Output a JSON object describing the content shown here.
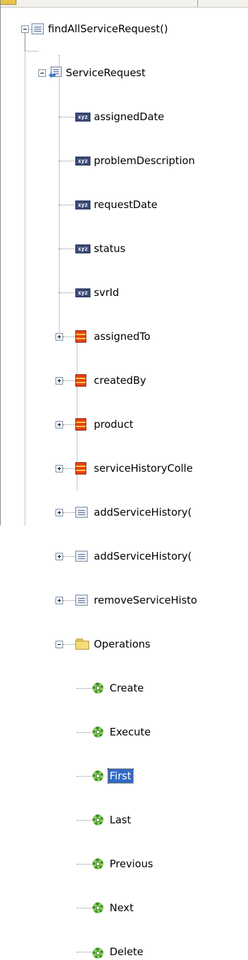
{
  "tree": {
    "root": {
      "label": "findAllServiceRequest()",
      "icon": "method-icon"
    },
    "return_node": {
      "label": "ServiceRequest",
      "icon": "return-collection-icon"
    },
    "attributes": [
      {
        "label": "assignedDate",
        "icon": "attribute-icon",
        "icon_text": "xyz"
      },
      {
        "label": "problemDescription",
        "icon": "attribute-icon",
        "icon_text": "xyz"
      },
      {
        "label": "requestDate",
        "icon": "attribute-icon",
        "icon_text": "xyz"
      },
      {
        "label": "status",
        "icon": "attribute-icon",
        "icon_text": "xyz"
      },
      {
        "label": "svrId",
        "icon": "attribute-icon",
        "icon_text": "xyz"
      }
    ],
    "accessors": [
      {
        "label": "assignedTo",
        "icon": "accessor-icon"
      },
      {
        "label": "createdBy",
        "icon": "accessor-icon"
      },
      {
        "label": "product",
        "icon": "accessor-icon"
      },
      {
        "label": "serviceHistoryColle",
        "icon": "accessor-icon"
      }
    ],
    "methods": [
      {
        "label": "addServiceHistory(",
        "icon": "method-icon"
      },
      {
        "label": "addServiceHistory(",
        "icon": "method-icon"
      },
      {
        "label": "removeServiceHisto",
        "icon": "method-icon"
      }
    ],
    "operations_folder": {
      "label": "Operations",
      "icon": "folder-icon"
    },
    "operations": [
      {
        "label": "Create",
        "icon": "operation-gear-icon"
      },
      {
        "label": "Execute",
        "icon": "operation-gear-icon"
      },
      {
        "label": "First",
        "icon": "operation-gear-icon",
        "selected": true
      },
      {
        "label": "Last",
        "icon": "operation-gear-icon"
      },
      {
        "label": "Previous",
        "icon": "operation-gear-icon"
      },
      {
        "label": "Next",
        "icon": "operation-gear-icon"
      },
      {
        "label": "Delete",
        "icon": "operation-gear-icon"
      }
    ]
  },
  "colors": {
    "selection": "#316ac5",
    "attribute_icon": "#3c4a78",
    "accessor_icon_red": "#e8401a",
    "accessor_icon_yellow": "#f5d23c",
    "folder": "#f5dc78",
    "gear": "#3f8f2a"
  }
}
